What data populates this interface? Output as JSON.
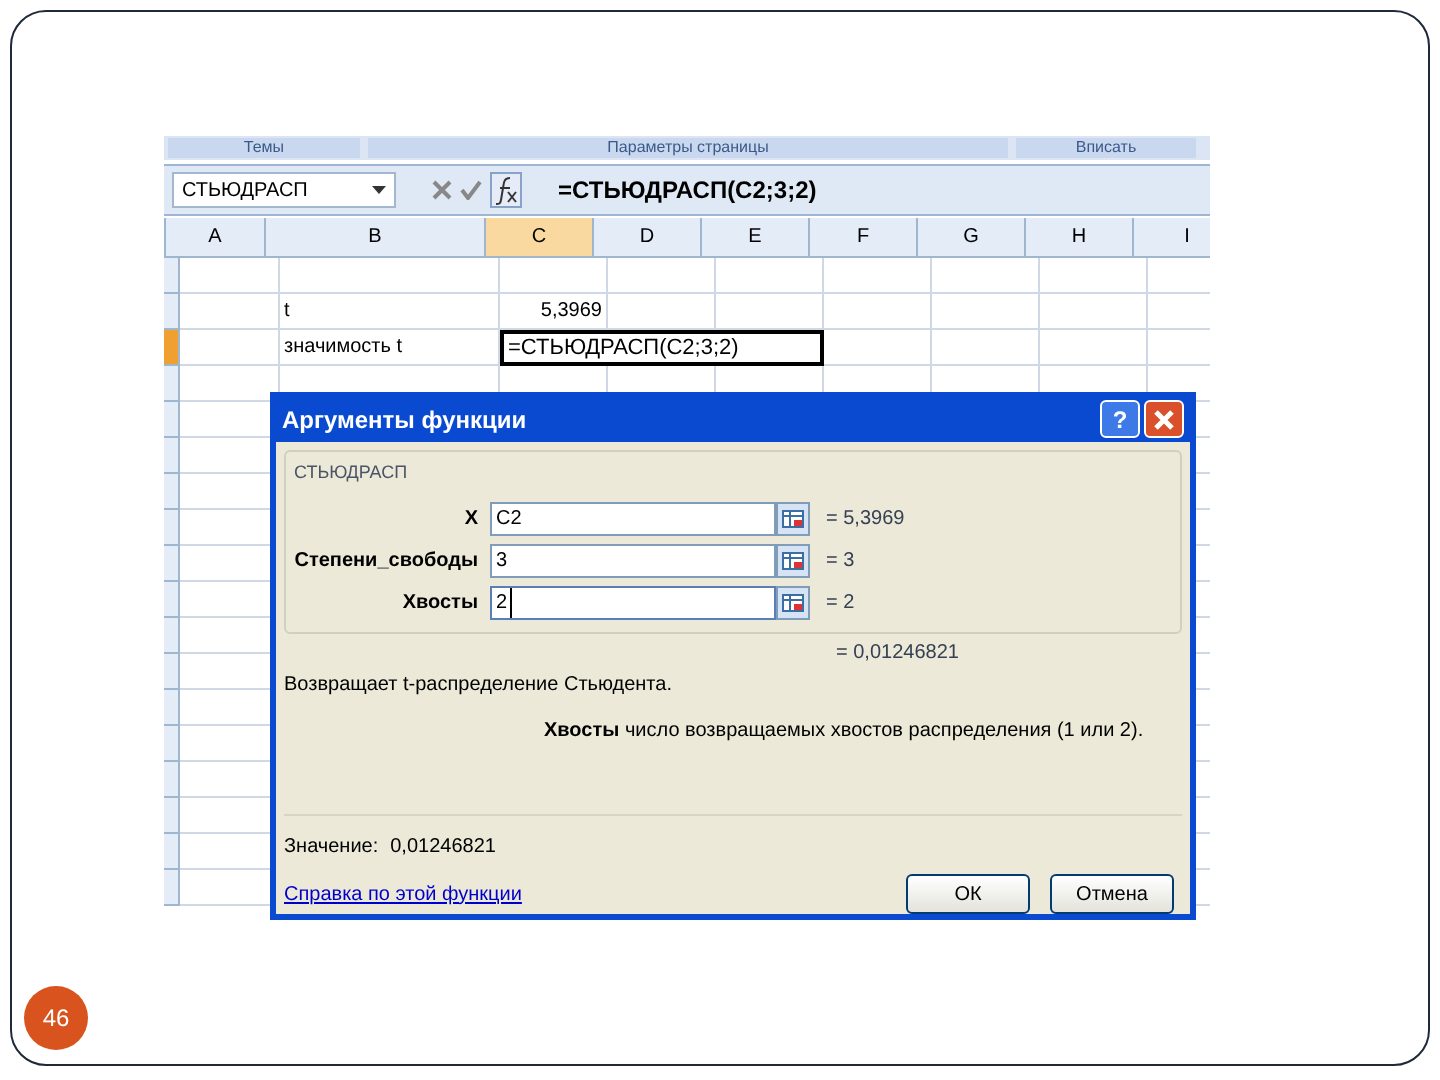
{
  "slide": {
    "page_number": "46"
  },
  "ribbon_groups": [
    "Темы",
    "Параметры страницы",
    "Вписать"
  ],
  "formula_bar": {
    "name_box": "СТЬЮДРАСП",
    "formula": "=СТЬЮДРАСП(C2;3;2)"
  },
  "sheet": {
    "columns": [
      {
        "label": "A",
        "selected": false
      },
      {
        "label": "B",
        "selected": false
      },
      {
        "label": "C",
        "selected": true
      },
      {
        "label": "D",
        "selected": false
      },
      {
        "label": "E",
        "selected": false
      },
      {
        "label": "F",
        "selected": false
      },
      {
        "label": "G",
        "selected": false
      },
      {
        "label": "H",
        "selected": false
      },
      {
        "label": "I",
        "selected": false
      }
    ],
    "rows": [
      {
        "selected": false,
        "cells": [
          {
            "text": "",
            "active": false
          },
          {
            "text": "",
            "active": false
          },
          {
            "text": "",
            "active": false
          }
        ]
      },
      {
        "selected": false,
        "cells": [
          {
            "text": "",
            "active": false
          },
          {
            "text": "t",
            "active": false
          },
          {
            "text": "5,3969",
            "active": false
          }
        ]
      },
      {
        "selected": true,
        "cells": [
          {
            "text": "",
            "active": false
          },
          {
            "text": "значимость t",
            "active": false
          },
          {
            "text": "=СТЬЮДРАСП(C2;3;2)",
            "active": true
          }
        ]
      }
    ]
  },
  "dialog": {
    "title": "Аргументы функции",
    "help_button": "?",
    "function_name": "СТЬЮДРАСП",
    "arguments": [
      {
        "label": "X",
        "value": "C2",
        "result": "= 5,3969",
        "focused": false
      },
      {
        "label": "Степени_свободы",
        "value": "3",
        "result": "= 3",
        "focused": false
      },
      {
        "label": "Хвосты",
        "value": "2",
        "result": "= 2",
        "focused": true
      }
    ],
    "formula_result": "= 0,01246821",
    "description": "Возвращает t-распределение Стьюдента.",
    "argument_help": "**Хвосты**   число возвращаемых хвостов распределения (1 или 2).",
    "value_label": "Значение:",
    "value": "0,01246821",
    "help_link": "Справка по этой функции",
    "buttons": [
      "ОК",
      "Отмена"
    ]
  }
}
